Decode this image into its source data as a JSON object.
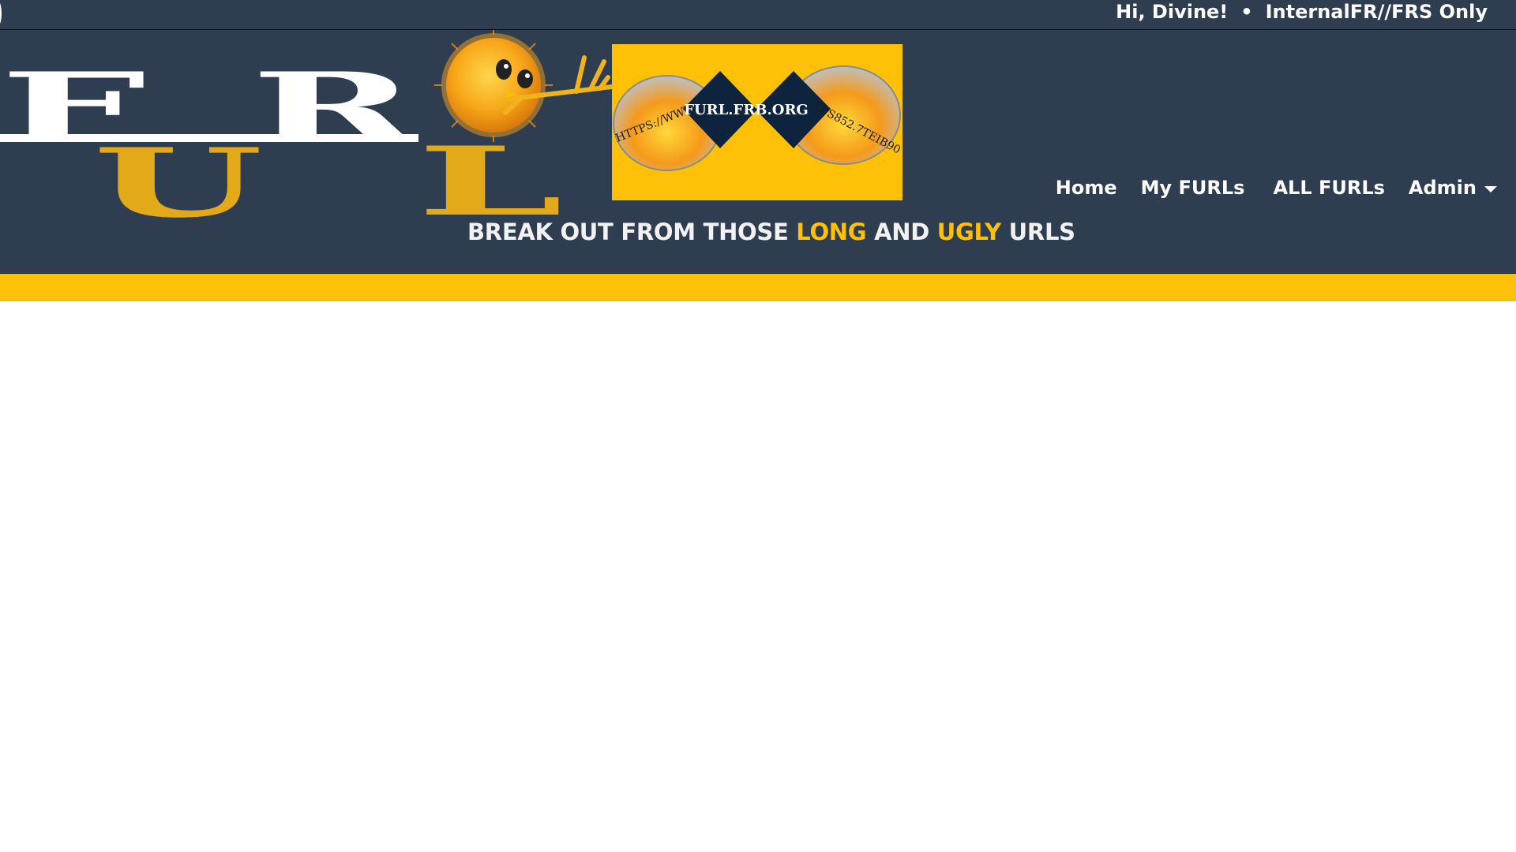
{
  "topbar": {
    "greeting": "Hi, Divine!",
    "separator": "•",
    "classification": "InternalFR//FRS Only"
  },
  "logo": {
    "letters": [
      "F",
      "U",
      "R",
      "L"
    ],
    "sign_domain": "FURL.FRB.ORG",
    "sign_left_text": "HTTPS://WWW",
    "sign_right_text": "LPS852.7TEIB90",
    "sign_color": "#ffc107",
    "letter_white": "#ffffff",
    "letter_gold": "#e2a919"
  },
  "tagline": {
    "part1": "BREAK OUT FROM THOSE ",
    "highlight1": "LONG",
    "part2": " AND ",
    "highlight2": "UGLY",
    "part3": " URLS"
  },
  "nav": {
    "home": "Home",
    "my_furls": "My FURLs",
    "all_furls": "ALL FURLs",
    "admin": "Admin"
  },
  "colors": {
    "header_bg": "#2e3d50",
    "accent": "#ffc107"
  }
}
